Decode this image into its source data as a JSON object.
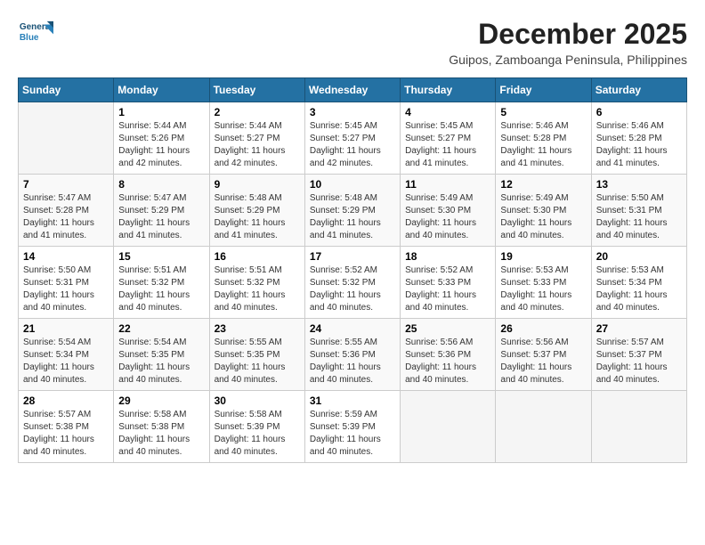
{
  "logo": {
    "general": "General",
    "blue": "Blue"
  },
  "title": {
    "month": "December 2025",
    "location": "Guipos, Zamboanga Peninsula, Philippines"
  },
  "weekdays": [
    "Sunday",
    "Monday",
    "Tuesday",
    "Wednesday",
    "Thursday",
    "Friday",
    "Saturday"
  ],
  "weeks": [
    [
      {
        "day": null,
        "info": null
      },
      {
        "day": "1",
        "sunrise": "5:44 AM",
        "sunset": "5:26 PM",
        "daylight": "11 hours and 42 minutes."
      },
      {
        "day": "2",
        "sunrise": "5:44 AM",
        "sunset": "5:27 PM",
        "daylight": "11 hours and 42 minutes."
      },
      {
        "day": "3",
        "sunrise": "5:45 AM",
        "sunset": "5:27 PM",
        "daylight": "11 hours and 42 minutes."
      },
      {
        "day": "4",
        "sunrise": "5:45 AM",
        "sunset": "5:27 PM",
        "daylight": "11 hours and 41 minutes."
      },
      {
        "day": "5",
        "sunrise": "5:46 AM",
        "sunset": "5:28 PM",
        "daylight": "11 hours and 41 minutes."
      },
      {
        "day": "6",
        "sunrise": "5:46 AM",
        "sunset": "5:28 PM",
        "daylight": "11 hours and 41 minutes."
      }
    ],
    [
      {
        "day": "7",
        "sunrise": "5:47 AM",
        "sunset": "5:28 PM",
        "daylight": "11 hours and 41 minutes."
      },
      {
        "day": "8",
        "sunrise": "5:47 AM",
        "sunset": "5:29 PM",
        "daylight": "11 hours and 41 minutes."
      },
      {
        "day": "9",
        "sunrise": "5:48 AM",
        "sunset": "5:29 PM",
        "daylight": "11 hours and 41 minutes."
      },
      {
        "day": "10",
        "sunrise": "5:48 AM",
        "sunset": "5:29 PM",
        "daylight": "11 hours and 41 minutes."
      },
      {
        "day": "11",
        "sunrise": "5:49 AM",
        "sunset": "5:30 PM",
        "daylight": "11 hours and 40 minutes."
      },
      {
        "day": "12",
        "sunrise": "5:49 AM",
        "sunset": "5:30 PM",
        "daylight": "11 hours and 40 minutes."
      },
      {
        "day": "13",
        "sunrise": "5:50 AM",
        "sunset": "5:31 PM",
        "daylight": "11 hours and 40 minutes."
      }
    ],
    [
      {
        "day": "14",
        "sunrise": "5:50 AM",
        "sunset": "5:31 PM",
        "daylight": "11 hours and 40 minutes."
      },
      {
        "day": "15",
        "sunrise": "5:51 AM",
        "sunset": "5:32 PM",
        "daylight": "11 hours and 40 minutes."
      },
      {
        "day": "16",
        "sunrise": "5:51 AM",
        "sunset": "5:32 PM",
        "daylight": "11 hours and 40 minutes."
      },
      {
        "day": "17",
        "sunrise": "5:52 AM",
        "sunset": "5:32 PM",
        "daylight": "11 hours and 40 minutes."
      },
      {
        "day": "18",
        "sunrise": "5:52 AM",
        "sunset": "5:33 PM",
        "daylight": "11 hours and 40 minutes."
      },
      {
        "day": "19",
        "sunrise": "5:53 AM",
        "sunset": "5:33 PM",
        "daylight": "11 hours and 40 minutes."
      },
      {
        "day": "20",
        "sunrise": "5:53 AM",
        "sunset": "5:34 PM",
        "daylight": "11 hours and 40 minutes."
      }
    ],
    [
      {
        "day": "21",
        "sunrise": "5:54 AM",
        "sunset": "5:34 PM",
        "daylight": "11 hours and 40 minutes."
      },
      {
        "day": "22",
        "sunrise": "5:54 AM",
        "sunset": "5:35 PM",
        "daylight": "11 hours and 40 minutes."
      },
      {
        "day": "23",
        "sunrise": "5:55 AM",
        "sunset": "5:35 PM",
        "daylight": "11 hours and 40 minutes."
      },
      {
        "day": "24",
        "sunrise": "5:55 AM",
        "sunset": "5:36 PM",
        "daylight": "11 hours and 40 minutes."
      },
      {
        "day": "25",
        "sunrise": "5:56 AM",
        "sunset": "5:36 PM",
        "daylight": "11 hours and 40 minutes."
      },
      {
        "day": "26",
        "sunrise": "5:56 AM",
        "sunset": "5:37 PM",
        "daylight": "11 hours and 40 minutes."
      },
      {
        "day": "27",
        "sunrise": "5:57 AM",
        "sunset": "5:37 PM",
        "daylight": "11 hours and 40 minutes."
      }
    ],
    [
      {
        "day": "28",
        "sunrise": "5:57 AM",
        "sunset": "5:38 PM",
        "daylight": "11 hours and 40 minutes."
      },
      {
        "day": "29",
        "sunrise": "5:58 AM",
        "sunset": "5:38 PM",
        "daylight": "11 hours and 40 minutes."
      },
      {
        "day": "30",
        "sunrise": "5:58 AM",
        "sunset": "5:39 PM",
        "daylight": "11 hours and 40 minutes."
      },
      {
        "day": "31",
        "sunrise": "5:59 AM",
        "sunset": "5:39 PM",
        "daylight": "11 hours and 40 minutes."
      },
      {
        "day": null,
        "info": null
      },
      {
        "day": null,
        "info": null
      },
      {
        "day": null,
        "info": null
      }
    ]
  ],
  "labels": {
    "sunrise_prefix": "Sunrise: ",
    "sunset_prefix": "Sunset: ",
    "daylight_prefix": "Daylight: "
  }
}
